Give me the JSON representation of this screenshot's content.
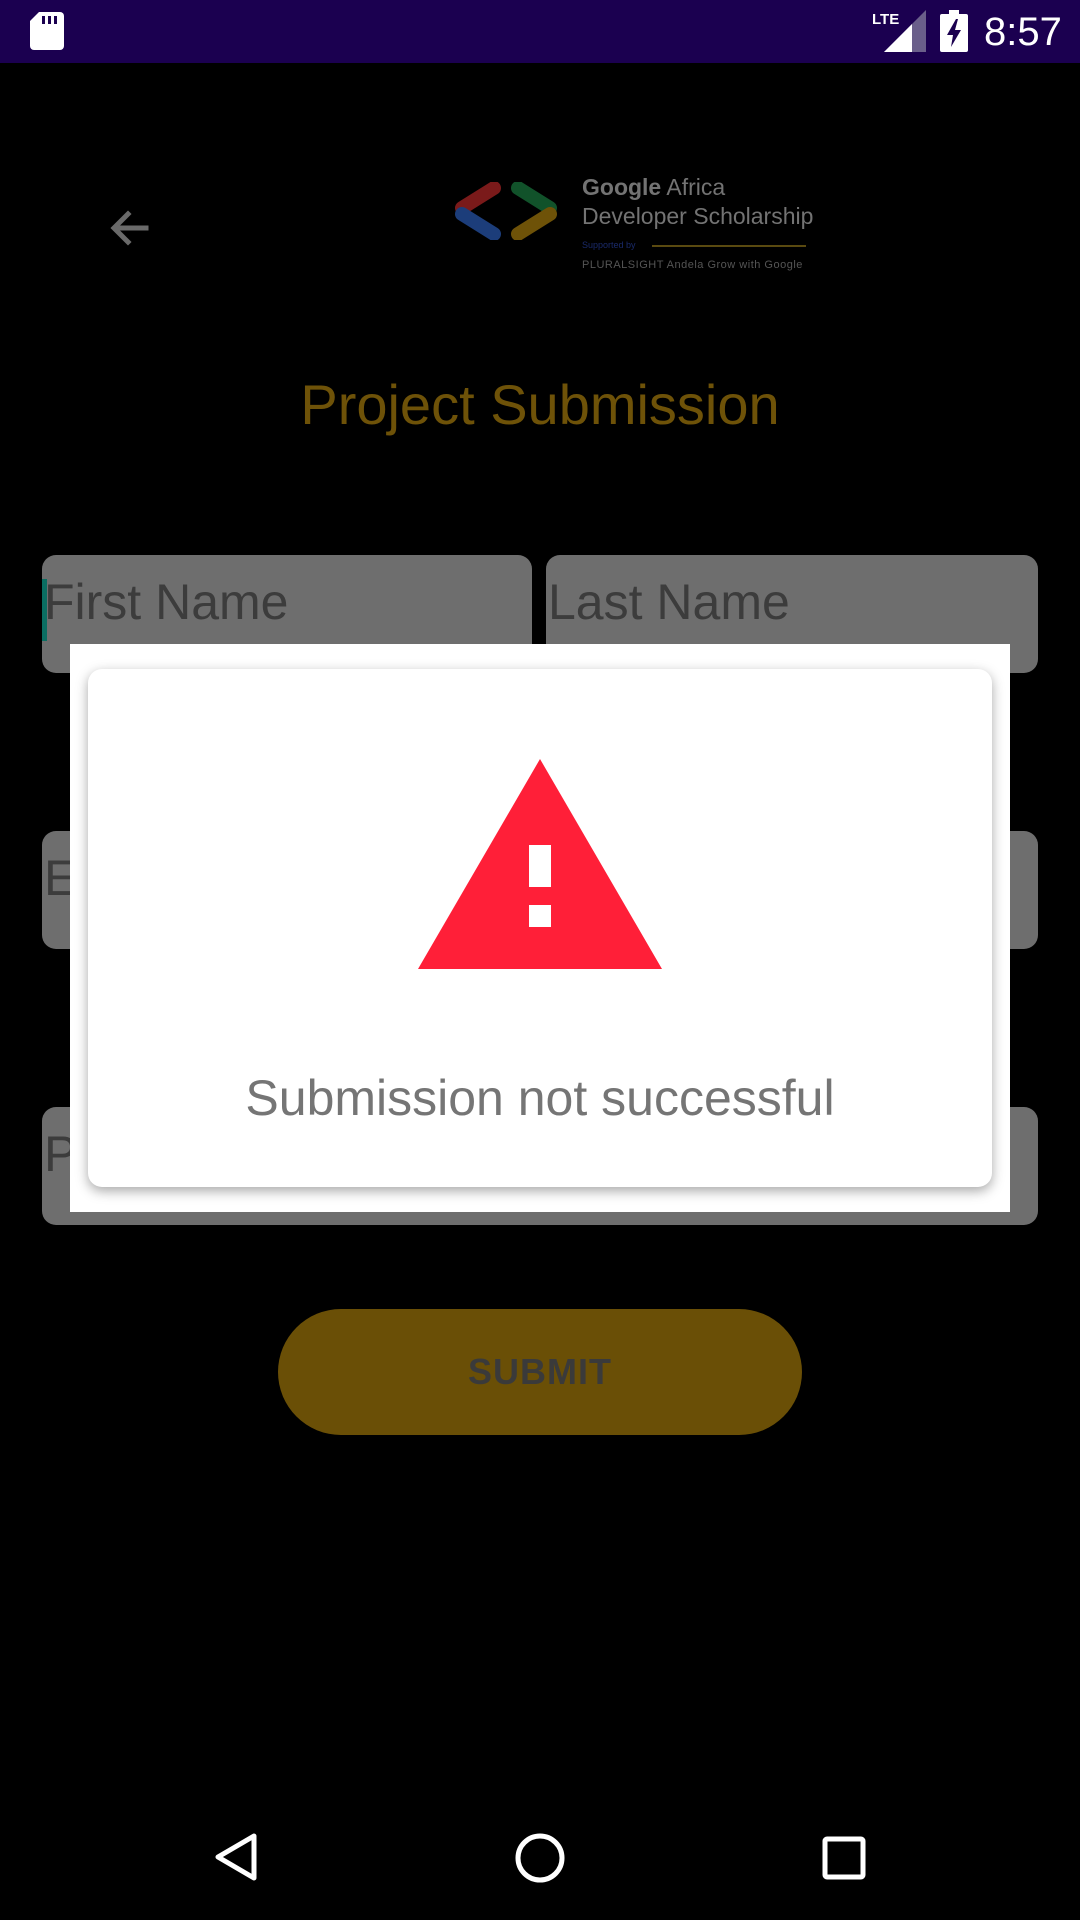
{
  "status_bar": {
    "time": "8:57",
    "network_label": "LTE",
    "icons": [
      "sd-card-icon",
      "lte-signal-icon",
      "battery-charging-icon"
    ]
  },
  "header": {
    "back_icon": "arrow-left-icon",
    "logo": {
      "brand": "Google",
      "line1_rest": " Africa",
      "line2": "Developer Scholarship",
      "supported_by": "Supported by",
      "partners": "PLURALSIGHT   Andela   Grow with Google"
    }
  },
  "page": {
    "title": "Project Submission"
  },
  "form": {
    "first_name": {
      "placeholder": "First Name"
    },
    "last_name": {
      "placeholder": "Last Name"
    },
    "email": {
      "placeholder": "E"
    },
    "project": {
      "placeholder": "P"
    },
    "submit_label": "SUBMIT"
  },
  "dialog": {
    "icon": "warning-triangle-icon",
    "message": "Submission not successful"
  },
  "colors": {
    "status_bar": "#1b0050",
    "accent_gold": "#f5b70e",
    "warning_red": "#ff1f38",
    "background": "#000000"
  },
  "nav_bar": {
    "icons": [
      "nav-back-icon",
      "nav-home-icon",
      "nav-recents-icon"
    ]
  }
}
